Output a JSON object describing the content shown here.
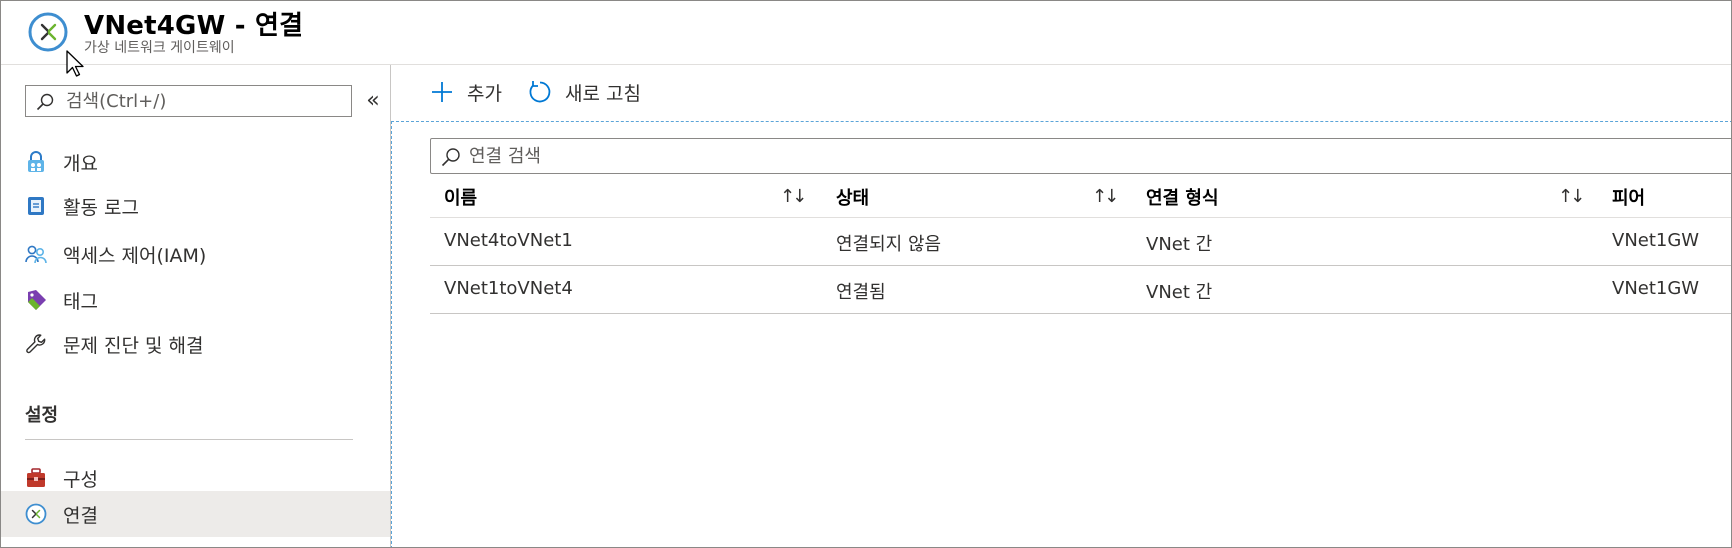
{
  "header": {
    "title": "VNet4GW - 연결",
    "subtitle": "가상 네트워크 게이트웨이"
  },
  "sidebar": {
    "search_placeholder": "검색(Ctrl+/)",
    "collapse_label": "«",
    "items": [
      {
        "label": "개요",
        "icon": "lock-people-icon"
      },
      {
        "label": "활동 로그",
        "icon": "activity-log-icon"
      },
      {
        "label": "액세스 제어(IAM)",
        "icon": "people-icon"
      },
      {
        "label": "태그",
        "icon": "tag-icon"
      },
      {
        "label": "문제 진단 및 해결",
        "icon": "wrench-icon"
      }
    ],
    "section_title": "설정",
    "settings_items": [
      {
        "label": "구성",
        "icon": "toolbox-icon"
      },
      {
        "label": "연결",
        "icon": "connection-icon",
        "selected": true
      }
    ]
  },
  "toolbar": {
    "add_label": "추가",
    "refresh_label": "새로 고침"
  },
  "filter": {
    "placeholder": "연결 검색"
  },
  "table": {
    "columns": [
      "이름",
      "상태",
      "연결 형식",
      "피어"
    ],
    "sort_glyph": "↑↓",
    "rows": [
      {
        "name": "VNet4toVNet1",
        "status": "연결되지 않음",
        "type": "VNet 간",
        "peer": "VNet1GW"
      },
      {
        "name": "VNet1toVNet4",
        "status": "연결됨",
        "type": "VNet 간",
        "peer": "VNet1GW"
      }
    ]
  },
  "colors": {
    "accent": "#0078d4",
    "selected_bg": "#edebe9",
    "focus_border": "#5ba4d8"
  }
}
